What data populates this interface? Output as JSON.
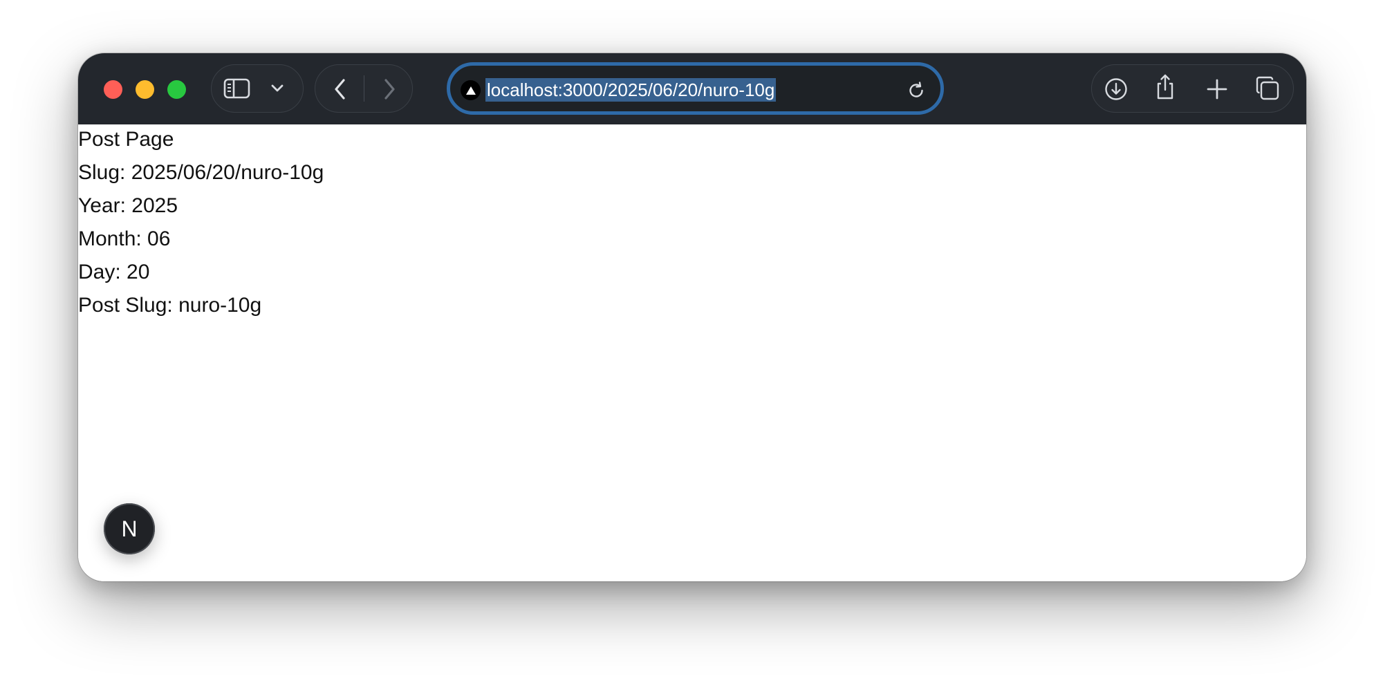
{
  "browser": {
    "address_bar": {
      "url": "localhost:3000/2025/06/20/nuro-10g"
    },
    "icons": {
      "sidebar": "sidebar-icon",
      "chevron": "chevron-down-icon",
      "back": "chevron-left-icon",
      "forward": "chevron-right-icon",
      "site": "vercel-triangle-icon",
      "reload": "reload-icon",
      "download": "download-icon",
      "share": "share-icon",
      "new_tab": "plus-icon",
      "tabs": "tab-overview-icon"
    },
    "colors": {
      "toolbar": "#23272d",
      "url_focus_ring": "#2e6aa8",
      "url_selection": "#37618f",
      "close": "#ff5f57",
      "minimize": "#febc2e",
      "zoom": "#28c840"
    }
  },
  "page": {
    "title": "Post Page",
    "slug": "Slug: 2025/06/20/nuro-10g",
    "year": "Year: 2025",
    "month": "Month: 06",
    "day": "Day: 20",
    "post_slug": "Post Slug: nuro-10g"
  },
  "dev_badge": {
    "letter": "N"
  }
}
